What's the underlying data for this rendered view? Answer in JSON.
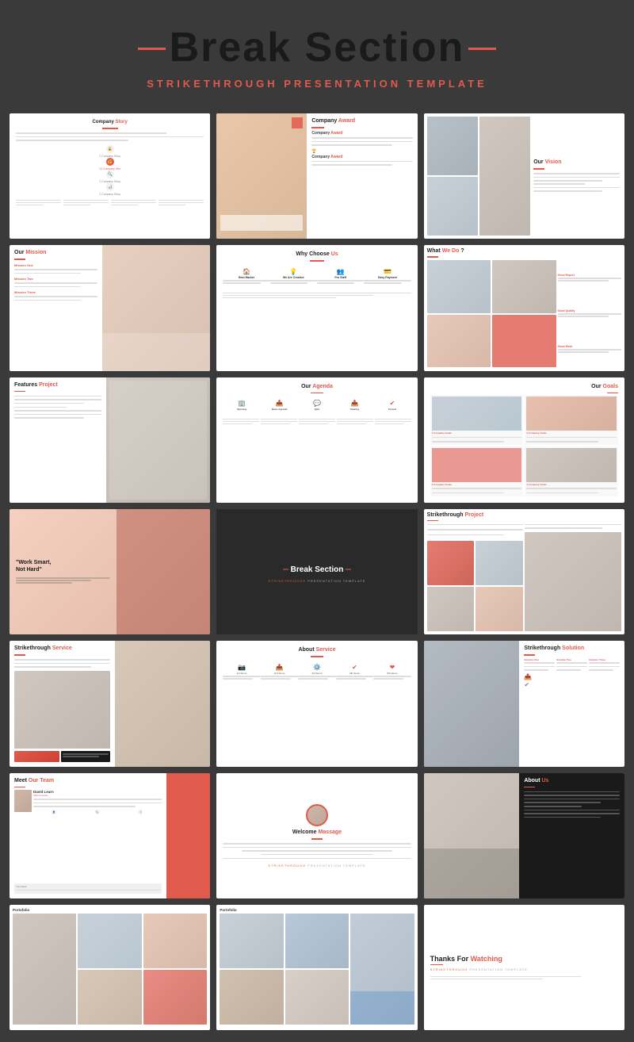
{
  "header": {
    "title": "Break Section",
    "subtitle_red": "STRIKETHROUGH",
    "subtitle_rest": " PRESENTATION TEMPLATE"
  },
  "slides": [
    {
      "id": 1,
      "type": "company-story",
      "title": "Company Story"
    },
    {
      "id": 2,
      "type": "company-award",
      "title": "Company Award"
    },
    {
      "id": 3,
      "type": "our-vision",
      "title": "Our Vision"
    },
    {
      "id": 4,
      "type": "our-mission",
      "title": "Our Mission"
    },
    {
      "id": 5,
      "type": "why-choose",
      "title": "Why Choose Us"
    },
    {
      "id": 6,
      "type": "what-we-do",
      "title": "What We Do ?"
    },
    {
      "id": 7,
      "type": "features-project",
      "title": "Features Project"
    },
    {
      "id": 8,
      "type": "our-agenda",
      "title": "Our Agenda"
    },
    {
      "id": 9,
      "type": "our-goals",
      "title": "Our Goals"
    },
    {
      "id": 10,
      "type": "quote",
      "title": "Work Smart, Not Hard"
    },
    {
      "id": 11,
      "type": "break-dark",
      "title": "Break Section"
    },
    {
      "id": 12,
      "type": "strikethrough-project",
      "title": "Strikethrough Project"
    },
    {
      "id": 13,
      "type": "strikethrough-service",
      "title": "Strikethrough Service"
    },
    {
      "id": 14,
      "type": "about-service",
      "title": "About Service"
    },
    {
      "id": 15,
      "type": "strikethrough-solution",
      "title": "Strikethrough Solution"
    },
    {
      "id": 16,
      "type": "meet-team",
      "title": "Meet Our Team"
    },
    {
      "id": 17,
      "type": "welcome-massage",
      "title": "Welcome Massage"
    },
    {
      "id": 18,
      "type": "about-us",
      "title": "About Us"
    },
    {
      "id": 19,
      "type": "portfolio-1",
      "title": "Portofolio"
    },
    {
      "id": 20,
      "type": "portfolio-2",
      "title": "Portofolio"
    },
    {
      "id": 21,
      "type": "thanks",
      "title": "Thanks For Watching"
    }
  ],
  "colors": {
    "accent": "#e05a4e",
    "dark_bg": "#2a2a2a",
    "light_bg": "#f8f8f8",
    "text_dark": "#1a1a1a",
    "text_gray": "#888888"
  }
}
